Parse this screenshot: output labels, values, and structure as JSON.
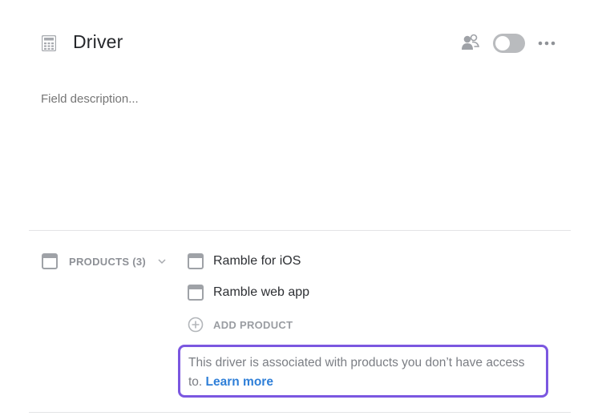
{
  "header": {
    "title": "Driver",
    "icons": {
      "field_type": "calculator-icon",
      "people": "people-icon",
      "more": "more-icon"
    },
    "toggle": {
      "state": "off"
    }
  },
  "description": {
    "placeholder": "Field description..."
  },
  "products": {
    "label": "PRODUCTS (3)",
    "items": [
      {
        "name": "Ramble for iOS"
      },
      {
        "name": "Ramble web app"
      }
    ],
    "add_label": "ADD PRODUCT",
    "notice": {
      "text": "This driver is associated with products you don’t have access to.",
      "link": "Learn more"
    }
  },
  "colors": {
    "accent_border": "#7b57e0",
    "link": "#2f7fd8",
    "muted_text": "#8d9096",
    "toggle_off": "#b9bbbe"
  }
}
